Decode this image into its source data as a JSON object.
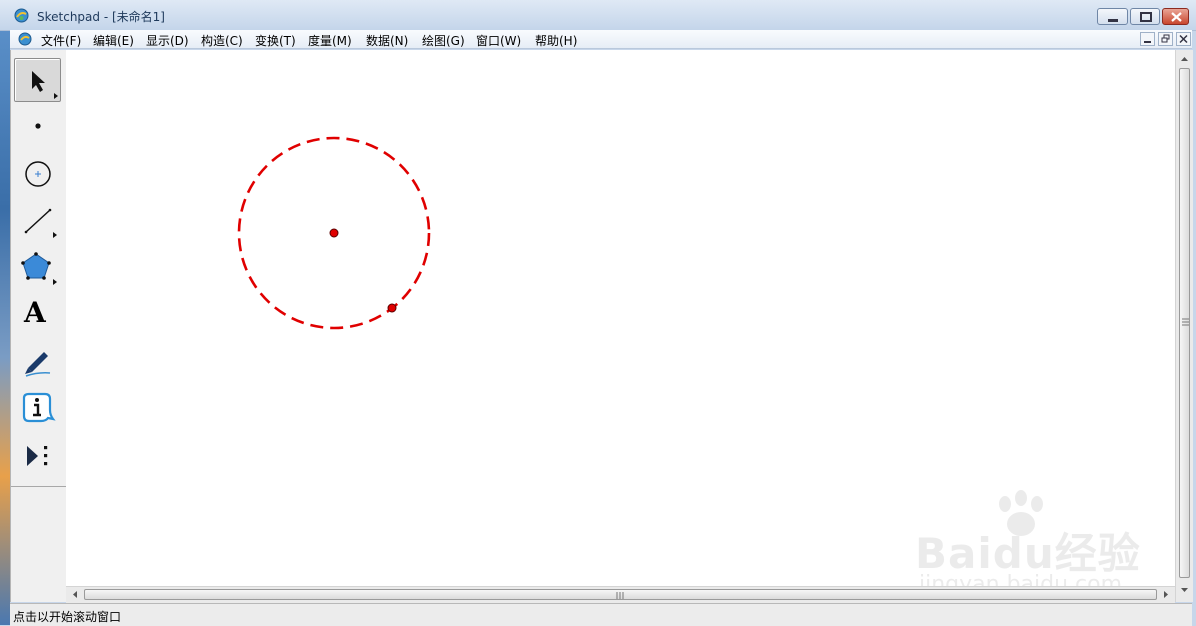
{
  "window": {
    "app_name": "Sketchpad",
    "title": "Sketchpad  - [未命名1]"
  },
  "menu": {
    "items": [
      {
        "label": "文件(F)"
      },
      {
        "label": "编辑(E)"
      },
      {
        "label": "显示(D)"
      },
      {
        "label": "构造(C)"
      },
      {
        "label": "变换(T)"
      },
      {
        "label": "度量(M)"
      },
      {
        "label": "数据(N)"
      },
      {
        "label": "绘图(G)"
      },
      {
        "label": "窗口(W)"
      },
      {
        "label": "帮助(H)"
      }
    ]
  },
  "toolbox": {
    "tools": [
      {
        "name": "arrow-tool",
        "icon": "arrow-icon",
        "active": true
      },
      {
        "name": "point-tool",
        "icon": "point-icon",
        "active": false
      },
      {
        "name": "compass-tool",
        "icon": "circle-icon",
        "active": false
      },
      {
        "name": "straightedge-tool",
        "icon": "line-icon",
        "active": false
      },
      {
        "name": "polygon-tool",
        "icon": "pentagon-icon",
        "active": false
      },
      {
        "name": "text-tool",
        "icon": "text-a-icon",
        "active": false
      },
      {
        "name": "marker-tool",
        "icon": "pen-icon",
        "active": false
      },
      {
        "name": "information-tool",
        "icon": "info-icon",
        "active": false
      },
      {
        "name": "custom-tool",
        "icon": "play-more-icon",
        "active": false
      }
    ],
    "text_tool_glyph": "A"
  },
  "canvas": {
    "circle_color": "#e00000",
    "circle_style": "dashed",
    "point_color": "#e00000"
  },
  "statusbar": {
    "text": "点击以开始滚动窗口"
  },
  "watermark": {
    "brand": "Baidu经验",
    "url": "jingyan.baidu.com"
  }
}
